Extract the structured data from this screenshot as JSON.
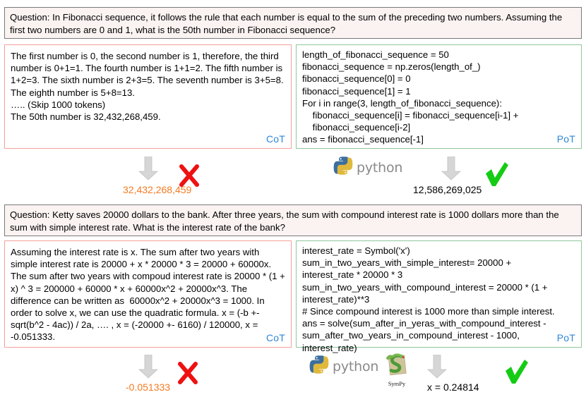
{
  "examples": [
    {
      "question": "Question: In Fibonacci sequence, it follows the rule that each number is equal to the sum of the preceding two numbers. Assuming the first two numbers are 0 and 1, what is the 50th number in Fibonacci sequence?",
      "cot": {
        "text": "The first number is 0, the second number is 1, therefore, the third number is 0+1=1. The fourth number is 1+1=2. The fifth number is 1+2=3. The sixth number is 2+3=5. The seventh number is 3+5=8. The eighth number is 5+8=13.\n….. (Skip 1000 tokens)\nThe 50th number is 32,432,268,459.",
        "label": "CoT",
        "answer": "32,432,268,459",
        "verdict": "cross"
      },
      "pot": {
        "text": "length_of_fibonacci_sequence = 50\nfibonacci_sequence = np.zeros(length_of_)\nfibonacci_sequence[0] = 0\nfibonacci_sequence[1] = 1\nFor i in range(3, length_of_fibonacci_sequence):\n    fibonacci_sequence[i] = fibonacci_sequence[i-1] +\n    fibonacci_sequence[i-2]\nans = fibonacci_sequence[-1]",
        "label": "PoT",
        "answer": "12,586,269,025",
        "verdict": "check",
        "tools": [
          "python"
        ]
      }
    },
    {
      "question": "Question: Ketty saves 20000 dollars to the bank. After three years, the sum with compound interest rate is 1000 dollars more than the sum with simple interest rate. What is the interest rate of the bank?",
      "cot": {
        "text": "Assuming the interest rate is x. The sum after two years with simple interest rate is 20000 + x * 20000 * 3 = 20000 + 60000x. The sum after two years with compoud interest rate is 20000 * (1 + x) ^ 3 = 200000 + 60000 * x + 60000x^2 + 20000x^3. The difference can be written as  60000x^2 + 20000x^3 = 1000. In order to solve x, we can use the quadratic formula. x = (-b +- sqrt(b^2 - 4ac)) / 2a, …. , x = (-20000 +- 6160) / 120000, x = -0.051333.",
        "label": "CoT",
        "answer": "-0.051333",
        "verdict": "cross"
      },
      "pot": {
        "text": "interest_rate = Symbol('x')\nsum_in_two_years_with_simple_interest= 20000 +\ninterest_rate * 20000 * 3\nsum_in_two_years_with_compound_interest = 20000 * (1 +\ninterest_rate)**3\n# Since compound interest is 1000 more than simple interest.\nans = solve(sum_after_in_yeras_with_compound_interest -\nsum_after_two_years_in_compound_interest - 1000,\ninterest_rate)",
        "label": "PoT",
        "answer": "x = 0.24814",
        "verdict": "check",
        "tools": [
          "python",
          "sympy"
        ]
      }
    }
  ],
  "logos": {
    "python_label": "python",
    "sympy_label": "SymPy"
  },
  "colors": {
    "cot_border": "#f4a19a",
    "pot_border": "#8fc79a",
    "question_bg": "#faf3f2",
    "tag": "#2f86d6",
    "wrong_answer": "#f47a20",
    "cross": "#ee1111",
    "check": "#15cc15",
    "arrow": "#d4d4d4"
  },
  "icons": {
    "arrow": "down-arrow-icon",
    "cross": "red-cross-icon",
    "check": "green-check-icon"
  }
}
